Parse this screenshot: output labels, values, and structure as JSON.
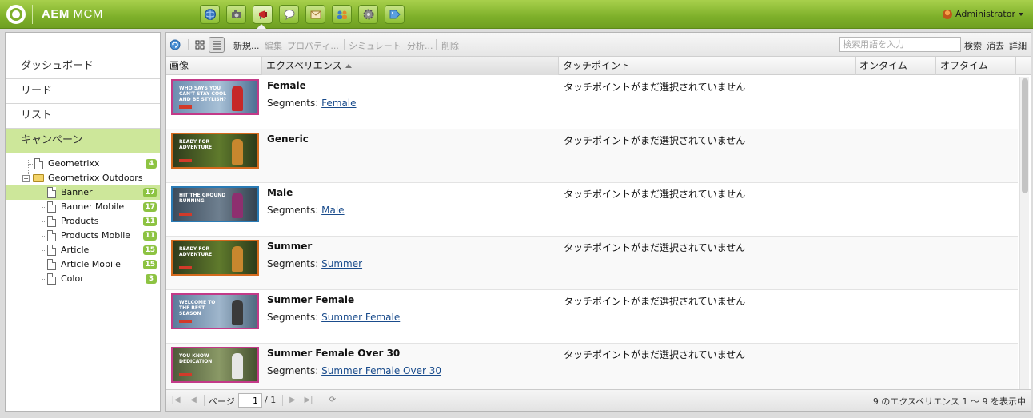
{
  "app": {
    "title_bold": "AEM",
    "title_rest": "MCM"
  },
  "nav_icons": [
    "globe-icon",
    "camera-icon",
    "megaphone-icon",
    "speech-bubble-icon",
    "envelope-icon",
    "people-icon",
    "gear-icon",
    "tag-icon"
  ],
  "user": {
    "name": "Administrator"
  },
  "sidebar": {
    "items": [
      {
        "label": "ダッシュボード"
      },
      {
        "label": "リード"
      },
      {
        "label": "リスト"
      },
      {
        "label": "キャンペーン"
      }
    ],
    "tree": [
      {
        "label": "Geometrixx",
        "count": "4"
      },
      {
        "label": "Geometrixx Outdoors"
      },
      {
        "label": "Banner",
        "count": "17"
      },
      {
        "label": "Banner Mobile",
        "count": "17"
      },
      {
        "label": "Products",
        "count": "11"
      },
      {
        "label": "Products Mobile",
        "count": "11"
      },
      {
        "label": "Article",
        "count": "15"
      },
      {
        "label": "Article Mobile",
        "count": "15"
      },
      {
        "label": "Color",
        "count": "3"
      }
    ]
  },
  "toolbar": {
    "new": "新規...",
    "edit": "編集",
    "properties": "プロパティ...",
    "simulate": "シミュレート",
    "analyze": "分析...",
    "delete": "削除",
    "search_placeholder": "検索用語を入力",
    "search": "検索",
    "clear": "消去",
    "detail": "詳細"
  },
  "columns": {
    "image": "画像",
    "experience": "エクスペリエンス",
    "touchpoint": "タッチポイント",
    "ontime": "オンタイム",
    "offtime": "オフタイム"
  },
  "rows": [
    {
      "title": "Female",
      "segments_label": "Segments:",
      "segment": "Female",
      "touchpoint": "タッチポイントがまだ選択されていません",
      "thumb_text": "WHO SAYS YOU CAN'T STAY COOL AND BE STYLISH?"
    },
    {
      "title": "Generic",
      "segments_label": "",
      "segment": "",
      "touchpoint": "タッチポイントがまだ選択されていません",
      "thumb_text": "READY FOR ADVENTURE"
    },
    {
      "title": "Male",
      "segments_label": "Segments:",
      "segment": "Male",
      "touchpoint": "タッチポイントがまだ選択されていません",
      "thumb_text": "HIT THE GROUND RUNNING"
    },
    {
      "title": "Summer",
      "segments_label": "Segments:",
      "segment": "Summer",
      "touchpoint": "タッチポイントがまだ選択されていません",
      "thumb_text": "READY FOR ADVENTURE"
    },
    {
      "title": "Summer Female",
      "segments_label": "Segments:",
      "segment": "Summer Female",
      "touchpoint": "タッチポイントがまだ選択されていません",
      "thumb_text": "WELCOME TO THE BEST SEASON"
    },
    {
      "title": "Summer Female Over 30",
      "segments_label": "Segments:",
      "segment": "Summer Female Over 30",
      "touchpoint": "タッチポイントがまだ選択されていません",
      "thumb_text": "YOU KNOW DEDICATION"
    }
  ],
  "pager": {
    "page_label": "ページ",
    "page_value": "1",
    "of_label": "/ 1",
    "summary": "9 のエクスペリエンス 1 〜 9 を表示中"
  }
}
